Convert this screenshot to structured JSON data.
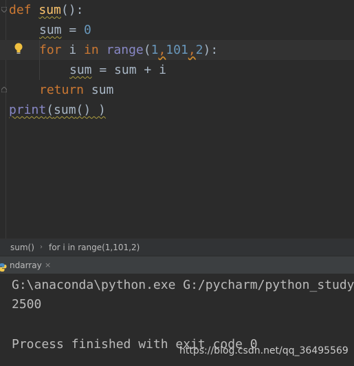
{
  "editor": {
    "tokens": {
      "def": "def",
      "sum": "sum",
      "paren_open": "(",
      "paren_close": ")",
      "colon": ":",
      "space": " ",
      "eq": " = ",
      "zero": "0",
      "for": "for",
      "i": "i",
      "in": "in",
      "range": "range",
      "one": "1",
      "comma": ",",
      "hundred_one": "101",
      "two": "2",
      "plus": " + ",
      "return": "return",
      "print": "print",
      "call_paren": "() )",
      "close_paren_tail": ")"
    }
  },
  "breadcrumb": {
    "item1": "sum()",
    "separator": "›",
    "item2": "for i in range(1,101,2)"
  },
  "run": {
    "tab_label": "ndarray",
    "tab_close": "×",
    "icon": "python-icon"
  },
  "console": {
    "line1": "G:\\anaconda\\python.exe G:/pycharm/python_study",
    "line2": "2500",
    "line3": "Process finished with exit code 0"
  },
  "watermark": "https://blog.csdn.net/qq_36495569",
  "colors": {
    "background": "#2b2b2b",
    "keyword": "#cc7832",
    "function": "#ffc66d",
    "number": "#6897bb",
    "builtin": "#8888c6",
    "text": "#a9b7c6"
  }
}
